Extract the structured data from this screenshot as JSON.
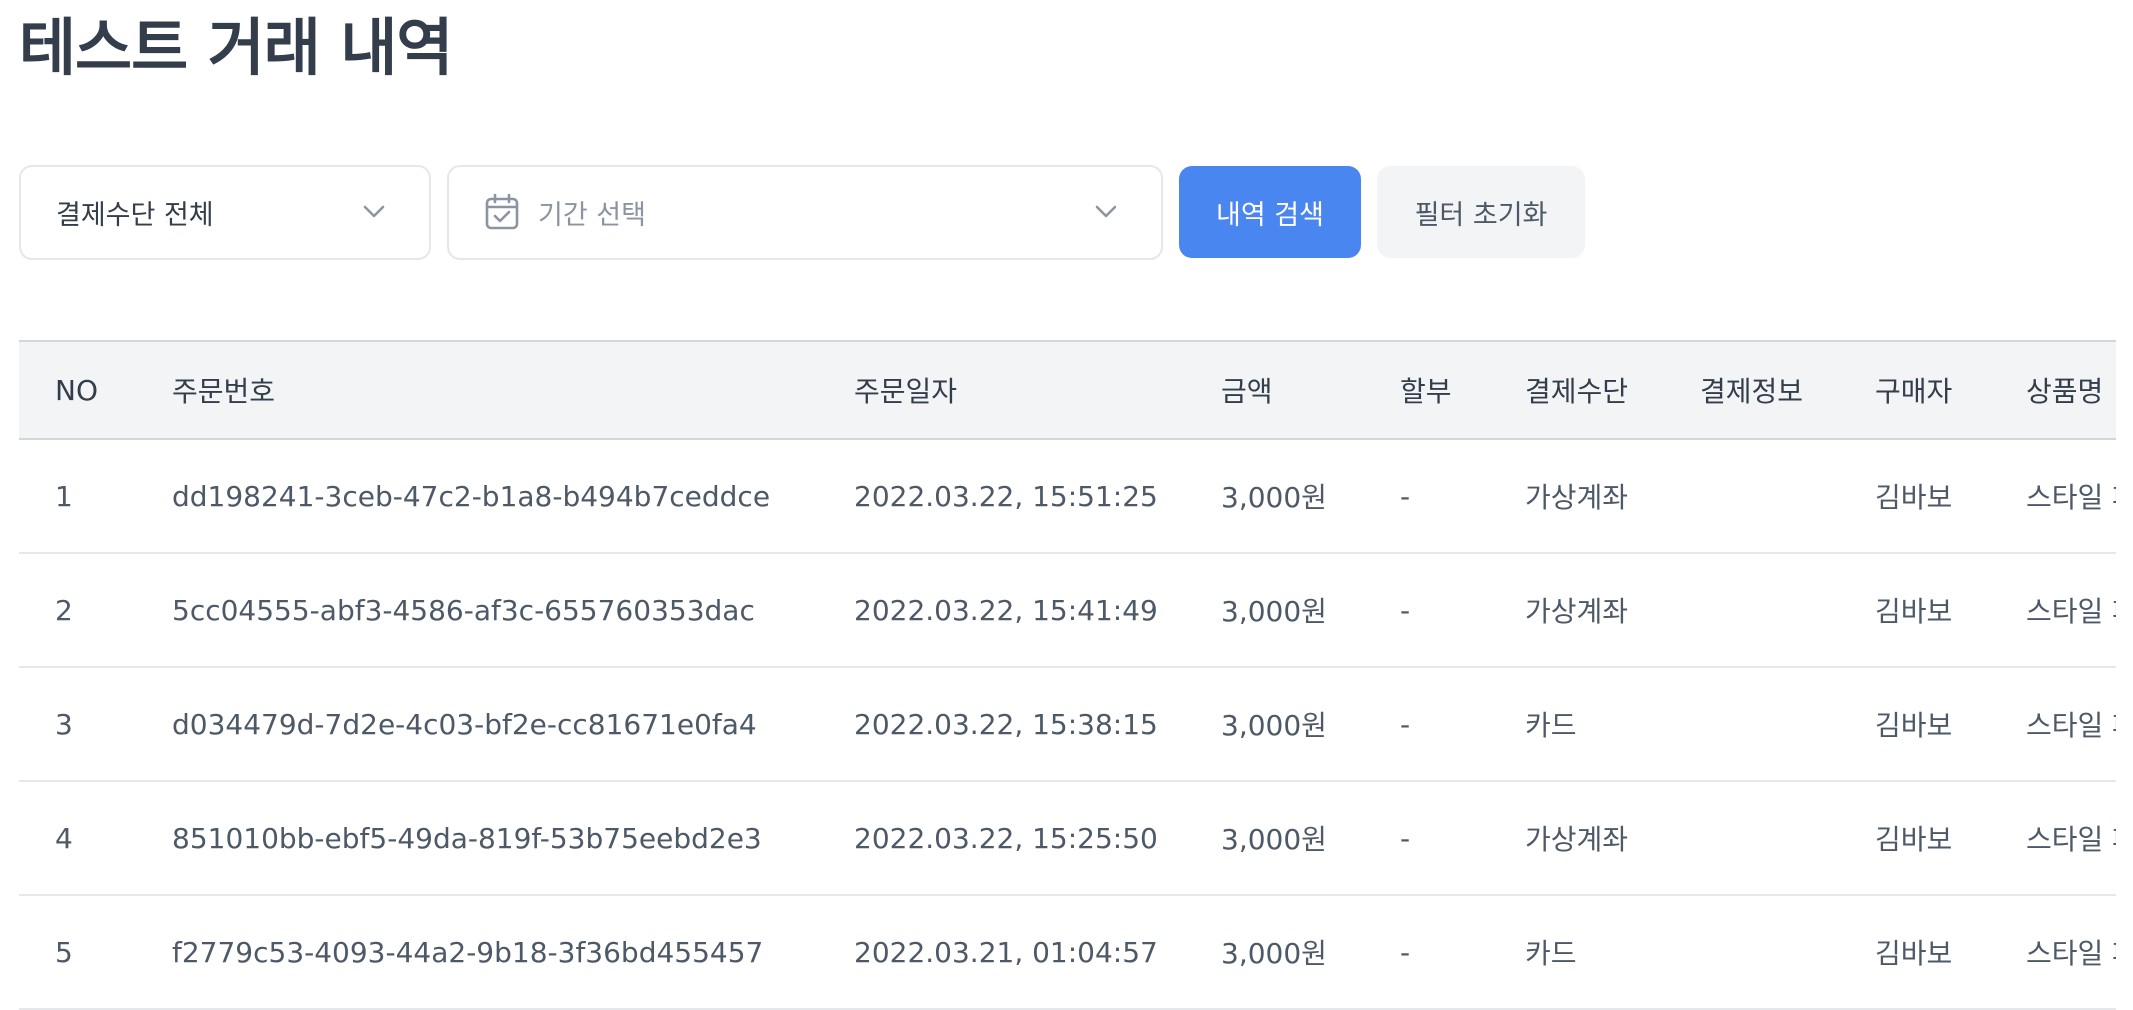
{
  "page": {
    "title": "테스트 거래 내역"
  },
  "filters": {
    "method_select": "결제수단 전체",
    "period_placeholder": "기간 선택",
    "search_button": "내역 검색",
    "reset_button": "필터 초기화"
  },
  "colors": {
    "primary": "#4a86f0",
    "header_bg": "#f2f4f6",
    "text": "#333d4b"
  },
  "table": {
    "headers": {
      "no": "NO",
      "order_id": "주문번호",
      "order_date": "주문일자",
      "amount": "금액",
      "installment": "할부",
      "method": "결제수단",
      "pay_info": "결제정보",
      "buyer": "구매자",
      "product": "상품명"
    },
    "rows": [
      {
        "no": "1",
        "order_id": "dd198241-3ceb-47c2-b1a8-b494b7ceddce",
        "order_date": "2022.03.22, 15:51:25",
        "amount": "3,000원",
        "installment": "-",
        "method": "가상계좌",
        "pay_info": "",
        "buyer": "김바보",
        "product": "스타일 패"
      },
      {
        "no": "2",
        "order_id": "5cc04555-abf3-4586-af3c-655760353dac",
        "order_date": "2022.03.22, 15:41:49",
        "amount": "3,000원",
        "installment": "-",
        "method": "가상계좌",
        "pay_info": "",
        "buyer": "김바보",
        "product": "스타일 패"
      },
      {
        "no": "3",
        "order_id": "d034479d-7d2e-4c03-bf2e-cc81671e0fa4",
        "order_date": "2022.03.22, 15:38:15",
        "amount": "3,000원",
        "installment": "-",
        "method": "카드",
        "pay_info": "",
        "buyer": "김바보",
        "product": "스타일 패"
      },
      {
        "no": "4",
        "order_id": "851010bb-ebf5-49da-819f-53b75eebd2e3",
        "order_date": "2022.03.22, 15:25:50",
        "amount": "3,000원",
        "installment": "-",
        "method": "가상계좌",
        "pay_info": "",
        "buyer": "김바보",
        "product": "스타일 패"
      },
      {
        "no": "5",
        "order_id": "f2779c53-4093-44a2-9b18-3f36bd455457",
        "order_date": "2022.03.21, 01:04:57",
        "amount": "3,000원",
        "installment": "-",
        "method": "카드",
        "pay_info": "",
        "buyer": "김바보",
        "product": "스타일 패"
      }
    ]
  }
}
